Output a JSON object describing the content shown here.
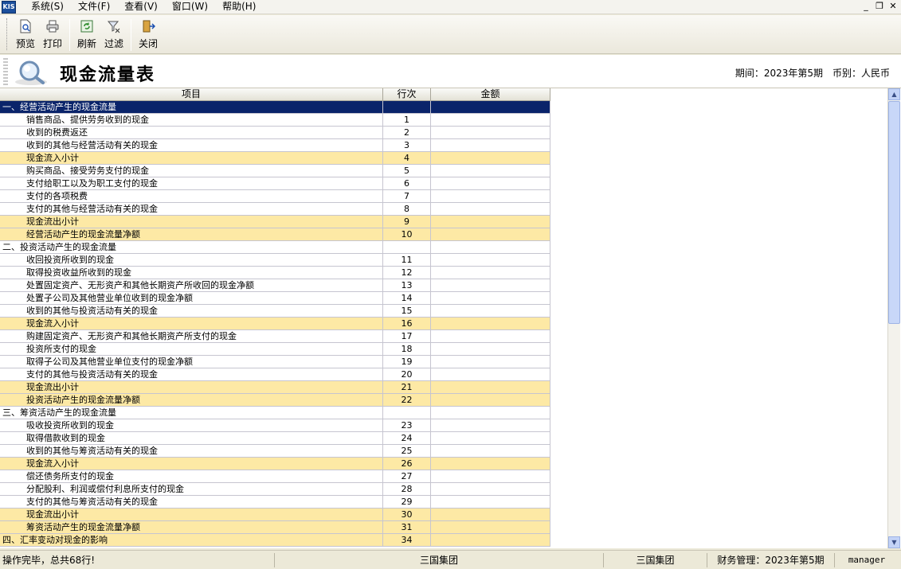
{
  "menu": {
    "app_icon": "KIS",
    "items": [
      "系统(S)",
      "文件(F)",
      "查看(V)",
      "窗口(W)",
      "帮助(H)"
    ]
  },
  "toolbar": {
    "preview": "预览",
    "print": "打印",
    "refresh": "刷新",
    "filter": "过滤",
    "close": "关闭"
  },
  "header": {
    "title": "现金流量表",
    "period": "期间：2023年第5期　币别：人民币"
  },
  "table": {
    "columns": [
      "项目",
      "行次",
      "金额"
    ],
    "rows": [
      {
        "item": "一、经营活动产生的现金流量",
        "line": "",
        "amount": "",
        "level": 1,
        "style": "selected"
      },
      {
        "item": "销售商品、提供劳务收到的现金",
        "line": "1",
        "amount": "",
        "level": 2,
        "style": "normal"
      },
      {
        "item": "收到的税费返还",
        "line": "2",
        "amount": "",
        "level": 2,
        "style": "normal"
      },
      {
        "item": "收到的其他与经营活动有关的现金",
        "line": "3",
        "amount": "",
        "level": 2,
        "style": "normal"
      },
      {
        "item": "现金流入小计",
        "line": "4",
        "amount": "",
        "level": 2,
        "style": "subtotal"
      },
      {
        "item": "购买商品、接受劳务支付的现金",
        "line": "5",
        "amount": "",
        "level": 2,
        "style": "normal"
      },
      {
        "item": "支付给职工以及为职工支付的现金",
        "line": "6",
        "amount": "",
        "level": 2,
        "style": "normal"
      },
      {
        "item": "支付的各项税费",
        "line": "7",
        "amount": "",
        "level": 2,
        "style": "normal"
      },
      {
        "item": "支付的其他与经营活动有关的现金",
        "line": "8",
        "amount": "",
        "level": 2,
        "style": "normal"
      },
      {
        "item": "现金流出小计",
        "line": "9",
        "amount": "",
        "level": 2,
        "style": "subtotal"
      },
      {
        "item": "经营活动产生的现金流量净额",
        "line": "10",
        "amount": "",
        "level": 2,
        "style": "subtotal"
      },
      {
        "item": "二、投资活动产生的现金流量",
        "line": "",
        "amount": "",
        "level": 1,
        "style": "normal"
      },
      {
        "item": "收回投资所收到的现金",
        "line": "11",
        "amount": "",
        "level": 2,
        "style": "normal"
      },
      {
        "item": "取得投资收益所收到的现金",
        "line": "12",
        "amount": "",
        "level": 2,
        "style": "normal"
      },
      {
        "item": "处置固定资产、无形资产和其他长期资产所收回的现金净额",
        "line": "13",
        "amount": "",
        "level": 2,
        "style": "normal"
      },
      {
        "item": "处置子公司及其他营业单位收到的现金净额",
        "line": "14",
        "amount": "",
        "level": 2,
        "style": "normal"
      },
      {
        "item": "收到的其他与投资活动有关的现金",
        "line": "15",
        "amount": "",
        "level": 2,
        "style": "normal"
      },
      {
        "item": "现金流入小计",
        "line": "16",
        "amount": "",
        "level": 2,
        "style": "subtotal"
      },
      {
        "item": "购建固定资产、无形资产和其他长期资产所支付的现金",
        "line": "17",
        "amount": "",
        "level": 2,
        "style": "normal"
      },
      {
        "item": "投资所支付的现金",
        "line": "18",
        "amount": "",
        "level": 2,
        "style": "normal"
      },
      {
        "item": "取得子公司及其他营业单位支付的现金净额",
        "line": "19",
        "amount": "",
        "level": 2,
        "style": "normal"
      },
      {
        "item": "支付的其他与投资活动有关的现金",
        "line": "20",
        "amount": "",
        "level": 2,
        "style": "normal"
      },
      {
        "item": "现金流出小计",
        "line": "21",
        "amount": "",
        "level": 2,
        "style": "subtotal"
      },
      {
        "item": "投资活动产生的现金流量净额",
        "line": "22",
        "amount": "",
        "level": 2,
        "style": "subtotal"
      },
      {
        "item": "三、筹资活动产生的现金流量",
        "line": "",
        "amount": "",
        "level": 1,
        "style": "normal"
      },
      {
        "item": "吸收投资所收到的现金",
        "line": "23",
        "amount": "",
        "level": 2,
        "style": "normal"
      },
      {
        "item": "取得借款收到的现金",
        "line": "24",
        "amount": "",
        "level": 2,
        "style": "normal"
      },
      {
        "item": "收到的其他与筹资活动有关的现金",
        "line": "25",
        "amount": "",
        "level": 2,
        "style": "normal"
      },
      {
        "item": "现金流入小计",
        "line": "26",
        "amount": "",
        "level": 2,
        "style": "subtotal"
      },
      {
        "item": "偿还债务所支付的现金",
        "line": "27",
        "amount": "",
        "level": 2,
        "style": "normal"
      },
      {
        "item": "分配股利、利润或偿付利息所支付的现金",
        "line": "28",
        "amount": "",
        "level": 2,
        "style": "normal"
      },
      {
        "item": "支付的其他与筹资活动有关的现金",
        "line": "29",
        "amount": "",
        "level": 2,
        "style": "normal"
      },
      {
        "item": "现金流出小计",
        "line": "30",
        "amount": "",
        "level": 2,
        "style": "subtotal"
      },
      {
        "item": "筹资活动产生的现金流量净额",
        "line": "31",
        "amount": "",
        "level": 2,
        "style": "subtotal"
      },
      {
        "item": "四、汇率变动对现金的影响",
        "line": "34",
        "amount": "",
        "level": 1,
        "style": "subtotal"
      }
    ]
  },
  "status": {
    "message": "操作完毕，总共68行!",
    "company": "三国集团",
    "company2": "三国集团",
    "module": "财务管理：2023年第5期",
    "user": "manager"
  },
  "colors": {
    "selected_row": "#0a246a",
    "subtotal_row": "#fde9a5"
  }
}
